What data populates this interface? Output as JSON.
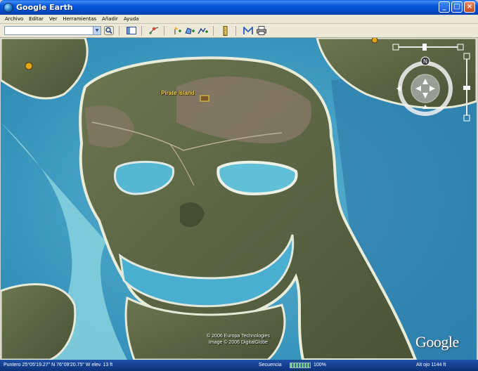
{
  "window": {
    "title": "Google Earth"
  },
  "window_buttons": {
    "minimize": "_",
    "maximize": "□",
    "close": "×"
  },
  "menu": [
    "Archivo",
    "Editar",
    "Ver",
    "Herramientas",
    "Añadir",
    "Ayuda"
  ],
  "search": {
    "value": "",
    "placeholder": ""
  },
  "map": {
    "place_label": "Pirate Island",
    "copyright_line1": "© 2006 Europa Technologies",
    "copyright_line2": "Image © 2006 DigitalGlobe",
    "logo": "Google"
  },
  "status": {
    "pointer": "Puntero 25°05'19.27\" N   76°09'20.75\" W  elev.   13 ft",
    "streaming": "Secuencia",
    "streaming_percent": "100%",
    "streaming_progress": 1.0,
    "eye_alt": "Alt ojo    1144 ft"
  },
  "colors": {
    "title_bar": "#0553d6",
    "water": "#3fa6c8",
    "land": "#55613f",
    "label": "#f4d24a",
    "statusbar": "#1e4fa8"
  },
  "icons": [
    "app-globe-icon",
    "search-icon",
    "sidebar-icon",
    "tour-icon",
    "placemark-icon",
    "polygon-icon",
    "path-icon",
    "ruler-icon",
    "email-icon",
    "print-icon",
    "navigation-compass-icon",
    "zoom-slider-icon",
    "tilt-slider-icon"
  ]
}
